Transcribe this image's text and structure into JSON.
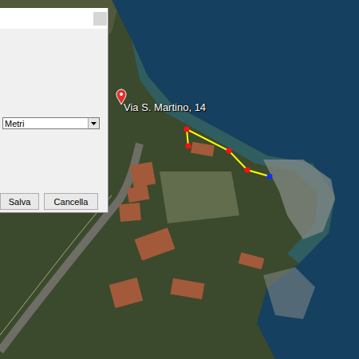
{
  "dialog": {
    "unit_select": {
      "value": "Metri"
    },
    "buttons": [
      {
        "label": "Salva"
      },
      {
        "label": "Cancella"
      }
    ]
  },
  "map": {
    "placemark": {
      "label": "Via S. Martino, 14"
    }
  }
}
